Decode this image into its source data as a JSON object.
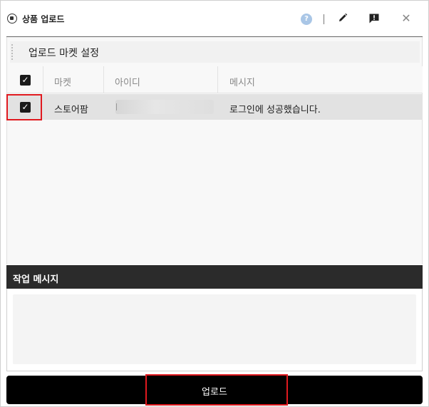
{
  "window": {
    "title": "상품 업로드",
    "icons": {
      "app": "app-logo-icon",
      "help": "help-icon",
      "help_glyph": "?",
      "edit": "pencil-icon",
      "report": "report-icon",
      "close": "close-icon",
      "close_glyph": "✕"
    }
  },
  "settings": {
    "section_title": "업로드 마켓 설정",
    "columns": {
      "market": "마켓",
      "id": "아이디",
      "message": "메시지"
    },
    "select_all_checked": true,
    "rows": [
      {
        "checked": true,
        "market": "스토어팜",
        "id": "",
        "message": "로그인에 성공했습니다."
      }
    ]
  },
  "work_message": {
    "title": "작업 메시지",
    "content": ""
  },
  "actions": {
    "upload_label": "업로드"
  },
  "colors": {
    "highlight": "#e0191f",
    "button_bg": "#000000",
    "header_bg": "#2b2b2b",
    "row_selected": "#e2e2e2",
    "help_icon": "#a9c6e6"
  }
}
